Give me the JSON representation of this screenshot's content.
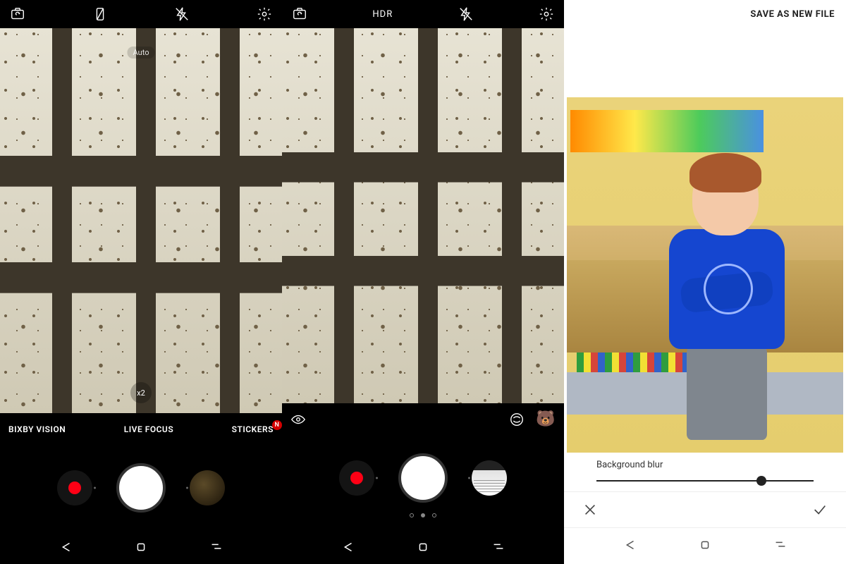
{
  "panel1": {
    "top": {
      "icons": [
        "switch-camera-icon",
        "screen-flash-icon",
        "flash-off-icon",
        "settings-icon"
      ]
    },
    "viewfinder": {
      "auto_label": "Auto",
      "zoom_label": "x2"
    },
    "modes": {
      "left": "BIXBY VISION",
      "center": "LIVE FOCUS",
      "right": "STICKERS",
      "right_badge": "N"
    }
  },
  "panel2": {
    "top": {
      "left_icon": "switch-camera-icon",
      "center_label": "HDR",
      "right_icons": [
        "flash-off-icon",
        "settings-icon"
      ]
    },
    "eye_row": {
      "left_icon": "eye-icon",
      "right_icons": [
        "filter-swirl-icon",
        "ar-mask-icon"
      ]
    },
    "pager_active_index": 1
  },
  "panel3": {
    "header_action": "SAVE AS NEW FILE",
    "slider": {
      "label": "Background blur",
      "value_percent": 76
    },
    "actions": {
      "left_icon": "close-icon",
      "right_icon": "check-icon"
    }
  },
  "navbar": {
    "icons": [
      "back-icon",
      "home-icon",
      "recents-icon"
    ]
  }
}
